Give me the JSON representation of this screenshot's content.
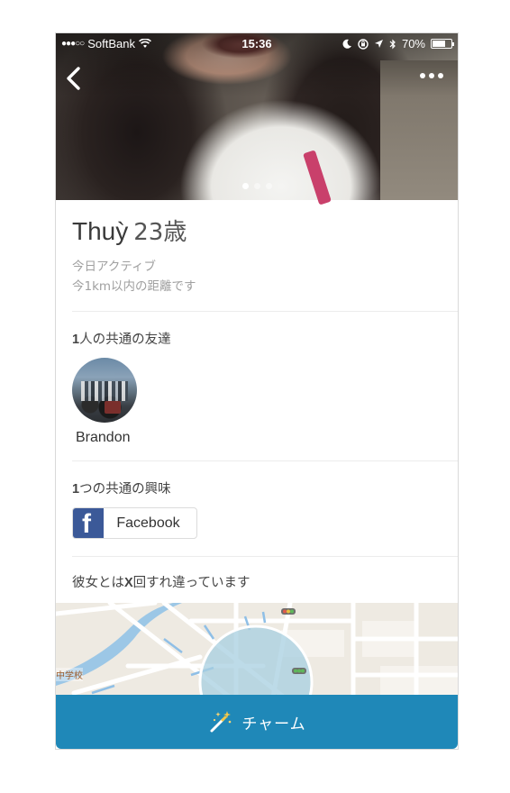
{
  "status_bar": {
    "signal": "●●●○○",
    "carrier": "SoftBank",
    "time": "15:36",
    "battery_percent": "70%",
    "battery_level": 0.7
  },
  "hero": {
    "page_count": 3,
    "active_page": 0
  },
  "profile": {
    "name": "Thuỳ",
    "age": "23歳",
    "active": "今日アクティブ",
    "distance": "今1km以内の距離です"
  },
  "mutual_friends": {
    "count": "1",
    "title_suffix": "人の共通の友達",
    "items": [
      {
        "name": "Brandon"
      }
    ]
  },
  "mutual_interests": {
    "count": "1",
    "title_suffix": "つの共通の興味",
    "items": [
      {
        "label": "Facebook",
        "icon": "facebook-icon"
      }
    ]
  },
  "crossed_paths": {
    "prefix": "彼女とは",
    "count": "X",
    "suffix": "回すれ違っています"
  },
  "map": {
    "label": "中学校"
  },
  "charm_button": {
    "label": "チャーム",
    "icon": "magic-wand-icon"
  },
  "colors": {
    "accent": "#1f88b8",
    "facebook": "#3b5998"
  }
}
